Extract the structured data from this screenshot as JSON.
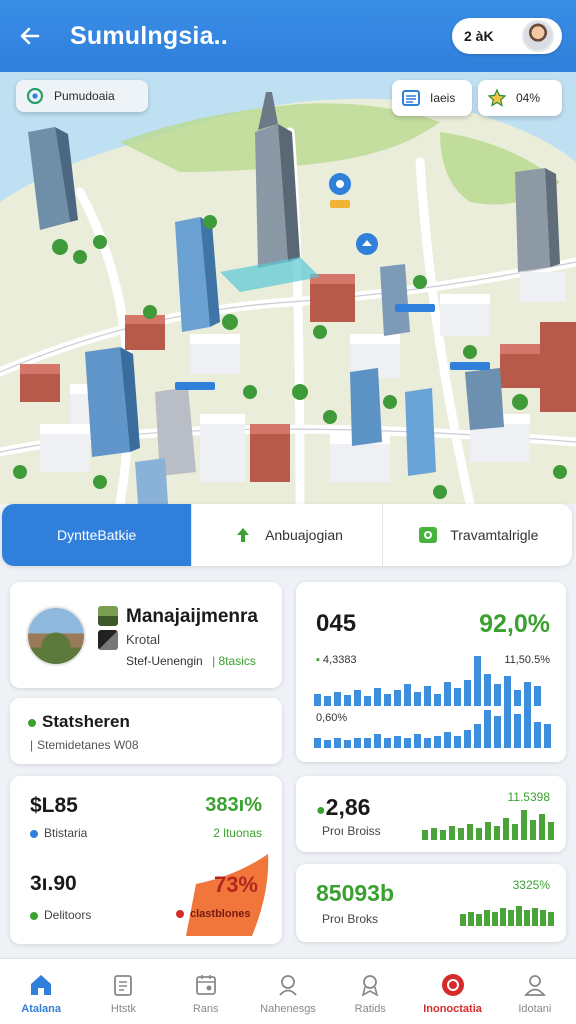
{
  "header": {
    "title": "Sumulngsia..",
    "pill_value": "2 àK",
    "back_icon": "arrow-left-icon"
  },
  "map": {
    "chip_left_label": "Pumudoaia",
    "chip_layers_label": "Iaeis",
    "chip_pct_label": "04%"
  },
  "tabs": [
    {
      "label": "DyntteBatkie",
      "active": true
    },
    {
      "label": "Anbuajogian",
      "active": false
    },
    {
      "label": "Travamtalrigle",
      "active": false
    }
  ],
  "profile_card": {
    "title": "Manajaijmenra",
    "subtitle": "Krotal",
    "line_label": "Stef-Uenengin",
    "line_badge": "| 8tasics"
  },
  "status_card": {
    "title": "Statsheren",
    "subtitle": "Stemidetanes W08"
  },
  "money_card": {
    "value1": "$L85",
    "pct1": "383ı%",
    "label1": "Btistaria",
    "sub1": "2 ltuonas",
    "value2": "3ı.90",
    "pct2": "73%",
    "label2": "Delitoors",
    "sub2": "clastblones",
    "accent": "#ef6a2a"
  },
  "chart_card_1": {
    "value": "045",
    "pct": "92,0%",
    "label_a": "4,3383",
    "label_b": "11,50.5%",
    "label_c": "0,60%"
  },
  "chart_card_2": {
    "value": "2,86",
    "label": "Proı Broiss",
    "right_value": "11.5398"
  },
  "chart_card_3": {
    "value": "85093b",
    "label": "Proı Broks",
    "right_value": "3325%"
  },
  "nav": [
    {
      "label": "Atalana",
      "icon": "home-icon",
      "state": "active"
    },
    {
      "label": "Htstk",
      "icon": "clipboard-icon",
      "state": "normal"
    },
    {
      "label": "Rans",
      "icon": "calendar-icon",
      "state": "normal"
    },
    {
      "label": "Nahenesgs",
      "icon": "user-search-icon",
      "state": "normal"
    },
    {
      "label": "Ratids",
      "icon": "badge-icon",
      "state": "normal"
    },
    {
      "label": "Inonoctatia",
      "icon": "record-icon",
      "state": "alert"
    },
    {
      "label": "Idotani",
      "icon": "profile-icon",
      "state": "normal"
    }
  ],
  "colors": {
    "primary": "#2f7fdb",
    "positive": "#3aa130",
    "alert": "#d62b2b",
    "bar_blue": "#3d8fde",
    "bar_green": "#4aa43a"
  }
}
